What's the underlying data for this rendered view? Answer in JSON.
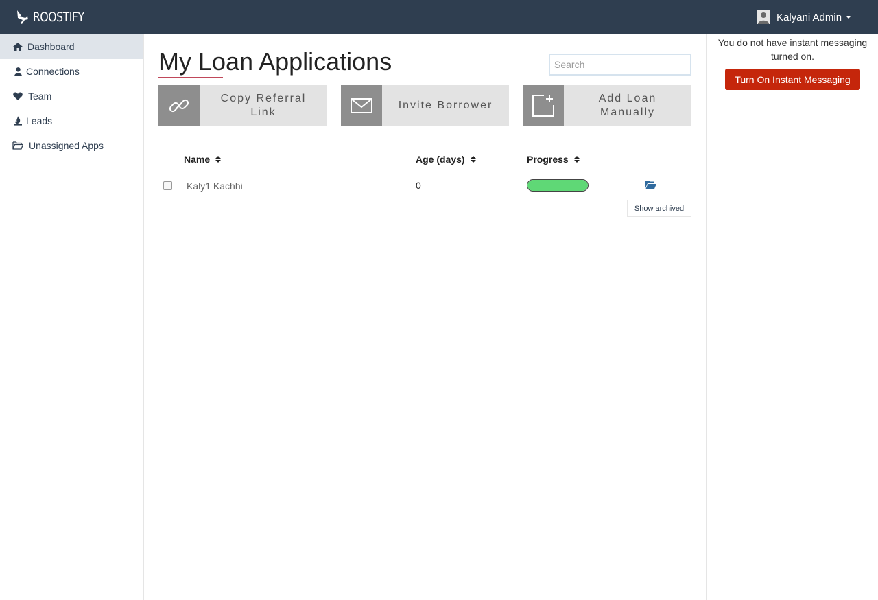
{
  "app": {
    "brand": "ROOSTIFY",
    "colors": {
      "topbar": "#2f3e50",
      "accent": "#c0485a",
      "primary_button": "#c5260b",
      "progress_fill": "#5fd876",
      "link": "#2f3e50"
    }
  },
  "user_menu": {
    "name": "Kalyani Admin",
    "icon": "user-avatar-icon"
  },
  "sidebar": {
    "items": [
      {
        "label": "Dashboard",
        "icon": "home-icon",
        "active": true
      },
      {
        "label": "Connections",
        "icon": "person-icon",
        "active": false
      },
      {
        "label": "Team",
        "icon": "heart-icon",
        "active": false
      },
      {
        "label": "Leads",
        "icon": "flame-icon",
        "active": false
      },
      {
        "label": "Unassigned Apps",
        "icon": "folder-open-icon",
        "active": false
      }
    ]
  },
  "main": {
    "title": "My Loan Applications",
    "search": {
      "placeholder": "Search",
      "value": ""
    },
    "actions": [
      {
        "label": "Copy Referral Link",
        "icon": "link-icon"
      },
      {
        "label": "Invite Borrower",
        "icon": "envelope-icon"
      },
      {
        "label": "Add Loan Manually",
        "icon": "add-document-icon"
      }
    ],
    "table": {
      "columns": [
        "Name",
        "Age (days)",
        "Progress"
      ],
      "rows": [
        {
          "name": "Kaly1 Kachhi",
          "age": "0",
          "progress": 1.0,
          "checked": false,
          "icon": "folder-open-icon"
        }
      ]
    },
    "show_archived": "Show archived"
  },
  "right_panel": {
    "message": "You do not have instant messaging turned on.",
    "button_label": "Turn On Instant Messaging"
  }
}
